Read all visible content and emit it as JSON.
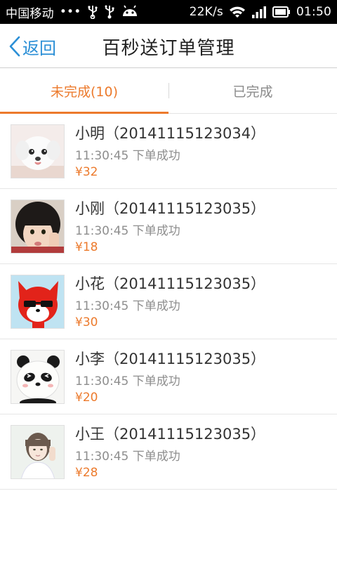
{
  "status_bar": {
    "carrier": "中国移动",
    "dots": "•••",
    "speed": "22K/s",
    "time": "01:50",
    "icons": [
      "usb-icon",
      "usb-debug-icon",
      "android-icon",
      "wifi-icon",
      "signal-icon",
      "battery-icon"
    ]
  },
  "header": {
    "back_label": "返回",
    "title": "百秒送订单管理"
  },
  "tabs": [
    {
      "label": "未完成(10)",
      "active": true
    },
    {
      "label": "已完成",
      "active": false
    }
  ],
  "orders": [
    {
      "title": "小明（20141115123034）",
      "status": "11:30:45 下单成功",
      "price": "¥32",
      "avatar": "white-puppy-avatar"
    },
    {
      "title": "小刚（20141115123035）",
      "status": "11:30:45 下单成功",
      "price": "¥18",
      "avatar": "little-girl-avatar"
    },
    {
      "title": "小花（20141115123035）",
      "status": "11:30:45 下单成功",
      "price": "¥30",
      "avatar": "red-fox-avatar"
    },
    {
      "title": "小李（20141115123035）",
      "status": "11:30:45 下单成功",
      "price": "¥20",
      "avatar": "panda-avatar"
    },
    {
      "title": "小王（20141115123035）",
      "status": "11:30:45 下单成功",
      "price": "¥28",
      "avatar": "girl-portrait-avatar"
    }
  ],
  "colors": {
    "accent": "#ec7a2c",
    "link": "#2b8fd6",
    "status_bar": "#000000"
  }
}
